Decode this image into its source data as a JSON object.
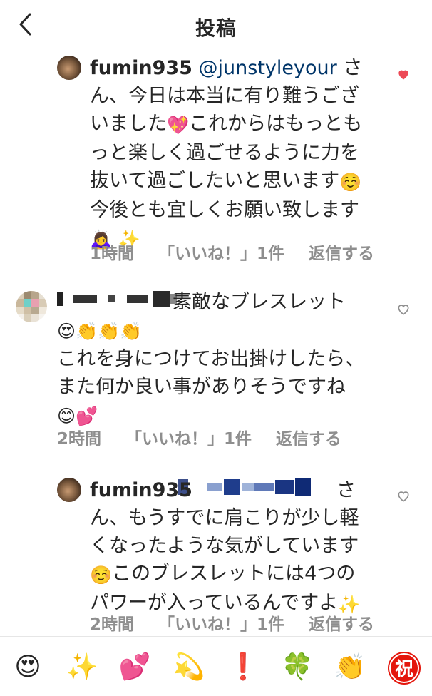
{
  "header": {
    "title": "投稿"
  },
  "comments": [
    {
      "username": "fumin935",
      "mention": "@junstyleyour",
      "lines": [
        "さん、今日は本当に有り難うござ",
        "いました",
        "これからはもっとも",
        "っと楽しく過ごせるように力を",
        "抜いて過ごしたいと思います",
        "今後とも宜しくお願い致します"
      ],
      "emojis": [
        "💖",
        "☺️",
        "🙇‍♀️",
        "✨"
      ],
      "time": "1時間",
      "likes": "「いいね！」1件",
      "reply": "返信する",
      "liked": true
    },
    {
      "text_line1": "素敵なブレスレット",
      "emojis_line2": [
        "😍",
        "👏",
        "👏",
        "👏"
      ],
      "lines": [
        "これを身につけてお出掛けしたら、",
        "また何か良い事がありそうですね"
      ],
      "emojis_line5": [
        "😊",
        "💕"
      ],
      "time": "2時間",
      "likes": "「いいね！」1件",
      "reply": "返信する",
      "liked": false
    },
    {
      "username": "fumin935",
      "lines": [
        "さ",
        "ん、もうすでに肩こりが少し軽",
        "くなったような気がしています",
        "このブレスレットには4つの",
        "パワーが入っているんですよ"
      ],
      "emojis": [
        "☺️",
        "✨"
      ],
      "time": "2時間",
      "likes": "「いいね！」1件",
      "reply": "返信する",
      "liked": false
    }
  ],
  "emoji_bar": [
    "😍",
    "✨",
    "💕",
    "💫",
    "❗",
    "🍀",
    "👏",
    "祝"
  ],
  "colors": {
    "like_red": "#ed4956",
    "meta_gray": "#8e8e8e",
    "mention_blue": "#003569"
  }
}
